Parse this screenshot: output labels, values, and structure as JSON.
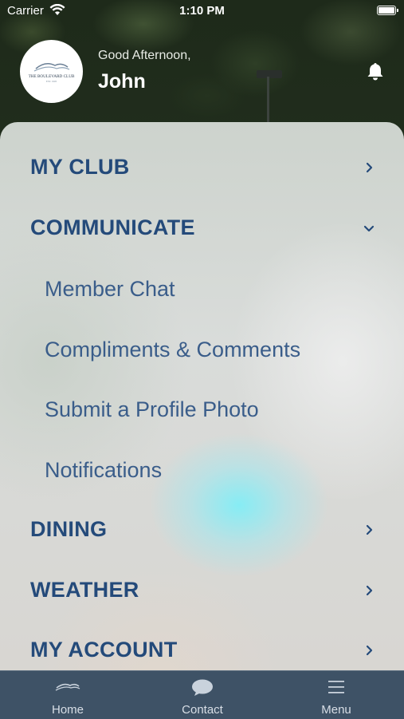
{
  "status_bar": {
    "carrier": "Carrier",
    "time": "1:10 PM"
  },
  "header": {
    "greeting": "Good Afternoon,",
    "username": "John",
    "logo_text": "THE BOULEVARD CLUB",
    "logo_subtext": "EST. 1905"
  },
  "menu": {
    "items": [
      {
        "label": "MY CLUB",
        "state": "collapsed"
      },
      {
        "label": "COMMUNICATE",
        "state": "expanded",
        "children": [
          "Member Chat",
          "Compliments & Comments",
          "Submit a Profile Photo",
          "Notifications"
        ]
      },
      {
        "label": "DINING",
        "state": "collapsed"
      },
      {
        "label": "WEATHER",
        "state": "collapsed"
      },
      {
        "label": "MY ACCOUNT",
        "state": "collapsed"
      }
    ]
  },
  "tabbar": {
    "tabs": [
      {
        "label": "Home",
        "icon": "club-logo-icon"
      },
      {
        "label": "Contact",
        "icon": "chat-bubble-icon"
      },
      {
        "label": "Menu",
        "icon": "hamburger-menu-icon"
      }
    ]
  },
  "colors": {
    "menu_heading": "#244a7a",
    "submenu_text": "#3a5d8a",
    "tabbar_bg": "#3e5266"
  }
}
